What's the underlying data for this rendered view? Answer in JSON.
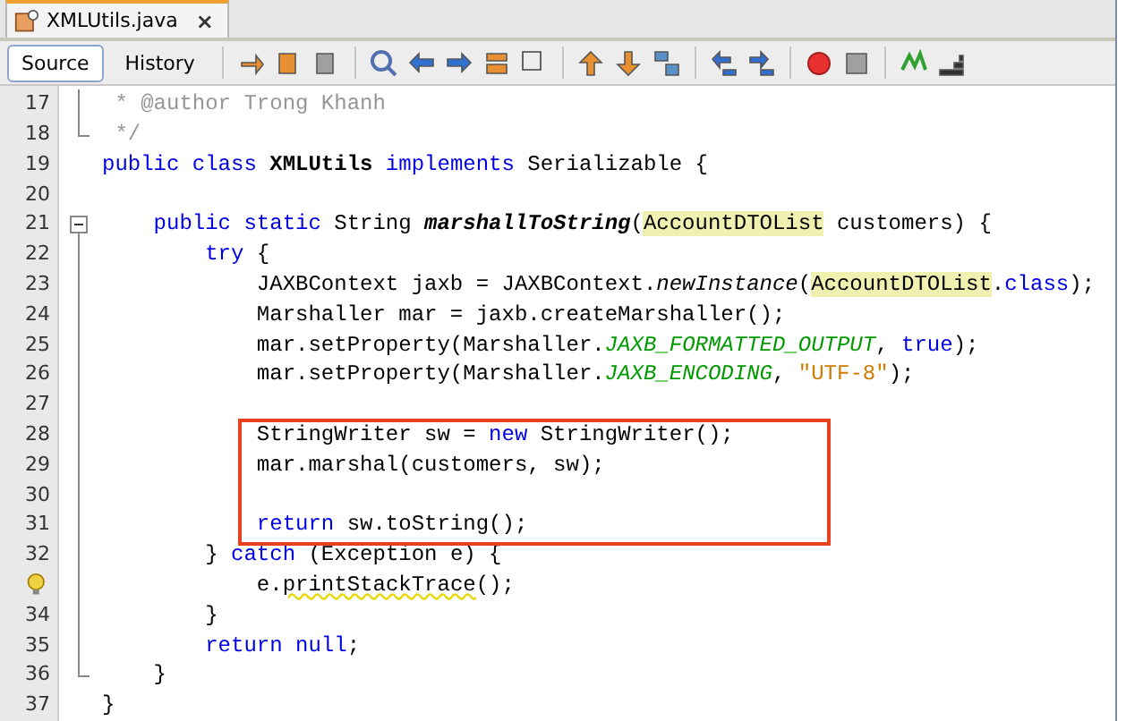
{
  "file_tab": {
    "title": "XMLUtils.java",
    "close": "×"
  },
  "view_tabs": [
    {
      "label": "Source",
      "selected": true
    },
    {
      "label": "History",
      "selected": false
    }
  ],
  "lines": [
    {
      "number": "17",
      "kind": "inside",
      "tokens": [
        {
          "kind": "comment",
          "text": " * @author Trong Khanh"
        }
      ]
    },
    {
      "number": "18",
      "kind": "foldend",
      "tokens": [
        {
          "kind": "comment",
          "text": " */"
        }
      ]
    },
    {
      "number": "19",
      "kind": "plain",
      "tokens": [
        {
          "kind": "keyword",
          "text": "public class "
        },
        {
          "kind": "bold",
          "text": "XMLUtils"
        },
        {
          "kind": "keyword",
          "text": " implements"
        },
        {
          "kind": "plain",
          "text": " Serializable {"
        }
      ]
    },
    {
      "number": "20",
      "kind": "plain"
    },
    {
      "number": "21",
      "kind": "foldstart",
      "tokens": [
        {
          "kind": "keyword",
          "text": "    public static"
        },
        {
          "kind": "plain",
          "text": " String "
        },
        {
          "kind": "bolditalic",
          "text": "marshallToString"
        },
        {
          "kind": "plain",
          "text": "("
        },
        {
          "kind": "highlight",
          "text": "AccountDTOList"
        },
        {
          "kind": "plain",
          "text": " customers) {"
        }
      ]
    },
    {
      "number": "22",
      "kind": "inside",
      "tokens": [
        {
          "kind": "keyword",
          "text": "        try"
        },
        {
          "kind": "plain",
          "text": " {"
        }
      ]
    },
    {
      "number": "23",
      "kind": "inside",
      "tokens": [
        {
          "kind": "plain",
          "text": "            JAXBContext jaxb = JAXBContext."
        },
        {
          "kind": "italic",
          "text": "newInstance"
        },
        {
          "kind": "plain",
          "text": "("
        },
        {
          "kind": "highlight",
          "text": "AccountDTOList"
        },
        {
          "kind": "plain",
          "text": "."
        },
        {
          "kind": "keyword",
          "text": "class"
        },
        {
          "kind": "plain",
          "text": ");"
        }
      ]
    },
    {
      "number": "24",
      "kind": "inside",
      "tokens": [
        {
          "kind": "plain",
          "text": "            Marshaller mar = jaxb.createMarshaller();"
        }
      ]
    },
    {
      "number": "25",
      "kind": "inside",
      "tokens": [
        {
          "kind": "plain",
          "text": "            mar.setProperty(Marshaller."
        },
        {
          "kind": "static",
          "text": "JAXB_FORMATTED_OUTPUT"
        },
        {
          "kind": "plain",
          "text": ", "
        },
        {
          "kind": "keyword",
          "text": "true"
        },
        {
          "kind": "plain",
          "text": ");"
        }
      ]
    },
    {
      "number": "26",
      "kind": "inside",
      "tokens": [
        {
          "kind": "plain",
          "text": "            mar.setProperty(Marshaller."
        },
        {
          "kind": "static",
          "text": "JAXB_ENCODING"
        },
        {
          "kind": "plain",
          "text": ", "
        },
        {
          "kind": "string",
          "text": "\"UTF-8\""
        },
        {
          "kind": "plain",
          "text": ");"
        }
      ]
    },
    {
      "number": "27",
      "kind": "inside"
    },
    {
      "number": "28",
      "kind": "inside",
      "boxed": true,
      "tokens": [
        {
          "kind": "plain",
          "text": "            StringWriter sw = "
        },
        {
          "kind": "keyword",
          "text": "new"
        },
        {
          "kind": "plain",
          "text": " StringWriter();"
        }
      ]
    },
    {
      "number": "29",
      "kind": "inside",
      "boxed": true,
      "tokens": [
        {
          "kind": "plain",
          "text": "            mar.marshal(customers, sw);"
        }
      ]
    },
    {
      "number": "30",
      "kind": "inside",
      "boxed": true
    },
    {
      "number": "31",
      "kind": "inside",
      "boxed": true,
      "tokens": [
        {
          "kind": "keyword",
          "text": "            return"
        },
        {
          "kind": "plain",
          "text": " sw.toString();"
        }
      ]
    },
    {
      "number": "32",
      "kind": "inside",
      "tokens": [
        {
          "kind": "plain",
          "text": "        } "
        },
        {
          "kind": "keyword",
          "text": "catch"
        },
        {
          "kind": "plain",
          "text": " (Exception e) {"
        }
      ]
    },
    {
      "hint": true,
      "kind": "inside",
      "tokens": [
        {
          "kind": "plain",
          "text": "            e."
        },
        {
          "kind": "warning",
          "text": "printStackTrace"
        },
        {
          "kind": "plain",
          "text": "();"
        }
      ]
    },
    {
      "number": "34",
      "kind": "inside",
      "tokens": [
        {
          "kind": "plain",
          "text": "        }"
        }
      ]
    },
    {
      "number": "35",
      "kind": "inside",
      "tokens": [
        {
          "kind": "keyword",
          "text": "        return null"
        },
        {
          "kind": "plain",
          "text": ";"
        }
      ]
    },
    {
      "number": "36",
      "kind": "foldend",
      "tokens": [
        {
          "kind": "plain",
          "text": "    }"
        }
      ]
    },
    {
      "number": "37",
      "kind": "plain",
      "tokens": [
        {
          "kind": "plain",
          "text": "}"
        }
      ]
    }
  ]
}
